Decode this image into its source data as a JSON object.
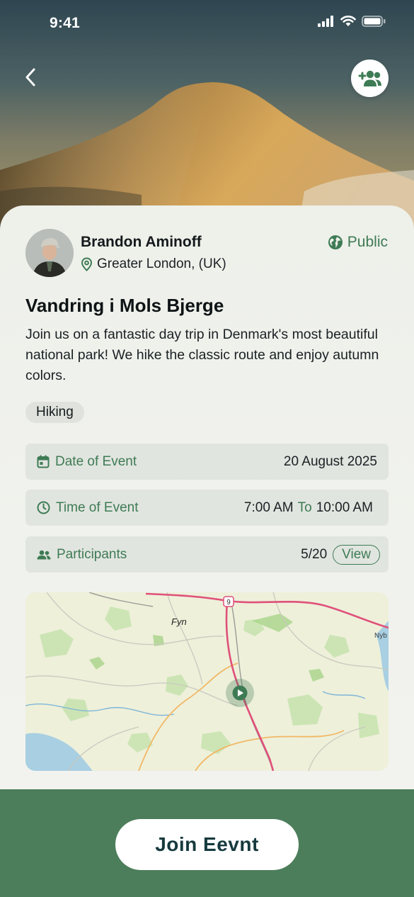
{
  "status_bar": {
    "time": "9:41"
  },
  "header": {
    "back_icon": "chevron-left-icon",
    "add_participant_icon": "add-group-icon"
  },
  "host": {
    "name": "Brandon Aminoff",
    "location": "Greater London, (UK)"
  },
  "visibility": {
    "label": "Public",
    "icon": "globe-icon"
  },
  "event": {
    "title": "Vandring i Mols Bjerge",
    "description": "Join us on a fantastic day trip in Denmark's most beautiful national park! We hike the classic route and enjoy autumn colors.",
    "tag": "Hiking"
  },
  "details": {
    "date_label": "Date of Event",
    "date_value": "20 August 2025",
    "time_label": "Time of Event",
    "time_start": "7:00 AM",
    "time_sep": "To",
    "time_end": "10:00 AM",
    "participants_label": "Participants",
    "participants_value": "5/20",
    "view_label": "View"
  },
  "map": {
    "place_label": "Fyn",
    "road_number": "9",
    "edge_label": "Nyb"
  },
  "footer": {
    "join_label": "Join Eevnt"
  },
  "colors": {
    "accent": "#3e7b55",
    "footer": "#4c7e5b",
    "join_text": "#163a3e"
  }
}
